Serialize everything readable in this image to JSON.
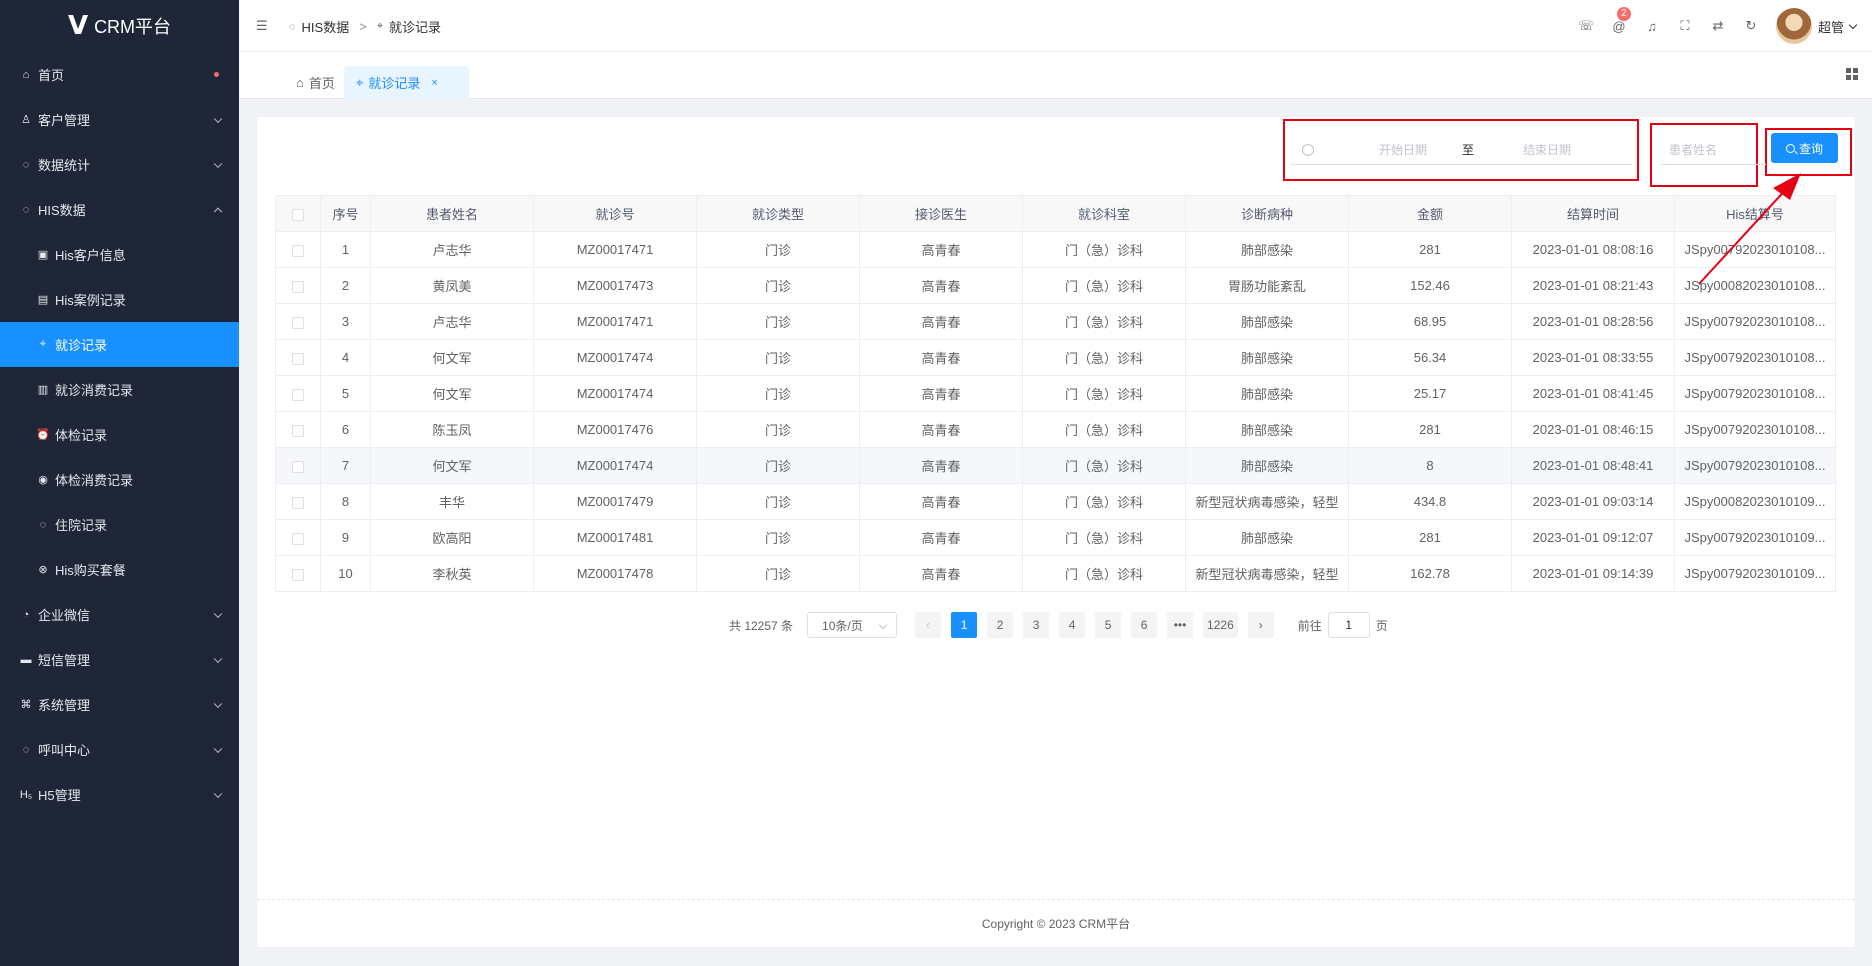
{
  "app": {
    "logo_glyph": "V",
    "title": "CRM平台"
  },
  "sidebar": {
    "items": [
      {
        "label": "首页",
        "icon": "home-icon",
        "glyph": "⌂",
        "has_dot": true
      },
      {
        "label": "客户管理",
        "icon": "user-icon",
        "glyph": "♙",
        "arrow": "down"
      },
      {
        "label": "数据统计",
        "icon": "chart-icon",
        "glyph": "◌",
        "arrow": "down"
      },
      {
        "label": "HIS数据",
        "icon": "data-icon",
        "glyph": "◌",
        "arrow": "up"
      },
      {
        "label": "His客户信息",
        "icon": "id-card-icon",
        "glyph": "▣",
        "sub": true
      },
      {
        "label": "His案例记录",
        "icon": "document-icon",
        "glyph": "▤",
        "sub": true
      },
      {
        "label": "就诊记录",
        "icon": "scan-icon",
        "glyph": "⌖",
        "sub": true,
        "active": true
      },
      {
        "label": "就诊消费记录",
        "icon": "wallet-icon",
        "glyph": "▥",
        "sub": true
      },
      {
        "label": "体检记录",
        "icon": "alarm-icon",
        "glyph": "⏰",
        "sub": true
      },
      {
        "label": "体检消费记录",
        "icon": "coin-icon",
        "glyph": "◉",
        "sub": true
      },
      {
        "label": "住院记录",
        "icon": "bed-icon",
        "glyph": "◌",
        "sub": true
      },
      {
        "label": "His购买套餐",
        "icon": "package-icon",
        "glyph": "⊗",
        "sub": true
      },
      {
        "label": "企业微信",
        "icon": "wechat-icon",
        "glyph": "◔",
        "arrow": "down"
      },
      {
        "label": "短信管理",
        "icon": "message-icon",
        "glyph": "▬",
        "arrow": "down"
      },
      {
        "label": "系统管理",
        "icon": "settings-icon",
        "glyph": "⌘",
        "arrow": "down"
      },
      {
        "label": "呼叫中心",
        "icon": "phone-call-icon",
        "glyph": "◌",
        "arrow": "down"
      },
      {
        "label": "H5管理",
        "icon": "h5-icon",
        "glyph": "H₅",
        "arrow": "down"
      }
    ]
  },
  "header": {
    "breadcrumb": [
      "HIS数据",
      "就诊记录"
    ],
    "separator": ">",
    "notification_count": "2",
    "username": "超管"
  },
  "tabs": [
    {
      "label": "首页",
      "icon": "home-icon"
    },
    {
      "label": "就诊记录",
      "icon": "scan-icon",
      "active": true,
      "close": "×"
    }
  ],
  "search": {
    "start_placeholder": "开始日期",
    "range_separator": "至",
    "end_placeholder": "结束日期",
    "name_placeholder": "患者姓名",
    "query_label": "查询"
  },
  "table": {
    "columns": [
      "序号",
      "患者姓名",
      "就诊号",
      "就诊类型",
      "接诊医生",
      "就诊科室",
      "诊断病种",
      "金额",
      "结算时间",
      "His结算号"
    ],
    "rows": [
      [
        "1",
        "卢志华",
        "MZ00017471",
        "门诊",
        "高青春",
        "门（急）诊科",
        "肺部感染",
        "281",
        "2023-01-01 08:08:16",
        "JSpy00792023010108..."
      ],
      [
        "2",
        "黄凤美",
        "MZ00017473",
        "门诊",
        "高青春",
        "门（急）诊科",
        "胃肠功能紊乱",
        "152.46",
        "2023-01-01 08:21:43",
        "JSpy00082023010108..."
      ],
      [
        "3",
        "卢志华",
        "MZ00017471",
        "门诊",
        "高青春",
        "门（急）诊科",
        "肺部感染",
        "68.95",
        "2023-01-01 08:28:56",
        "JSpy00792023010108..."
      ],
      [
        "4",
        "何文军",
        "MZ00017474",
        "门诊",
        "高青春",
        "门（急）诊科",
        "肺部感染",
        "56.34",
        "2023-01-01 08:33:55",
        "JSpy00792023010108..."
      ],
      [
        "5",
        "何文军",
        "MZ00017474",
        "门诊",
        "高青春",
        "门（急）诊科",
        "肺部感染",
        "25.17",
        "2023-01-01 08:41:45",
        "JSpy00792023010108..."
      ],
      [
        "6",
        "陈玉凤",
        "MZ00017476",
        "门诊",
        "高青春",
        "门（急）诊科",
        "肺部感染",
        "281",
        "2023-01-01 08:46:15",
        "JSpy00792023010108..."
      ],
      [
        "7",
        "何文军",
        "MZ00017474",
        "门诊",
        "高青春",
        "门（急）诊科",
        "肺部感染",
        "8",
        "2023-01-01 08:48:41",
        "JSpy00792023010108..."
      ],
      [
        "8",
        "丰华",
        "MZ00017479",
        "门诊",
        "高青春",
        "门（急）诊科",
        "新型冠状病毒感染，轻型",
        "434.8",
        "2023-01-01 09:03:14",
        "JSpy00082023010109..."
      ],
      [
        "9",
        "欧高阳",
        "MZ00017481",
        "门诊",
        "高青春",
        "门（急）诊科",
        "肺部感染",
        "281",
        "2023-01-01 09:12:07",
        "JSpy00792023010109..."
      ],
      [
        "10",
        "李秋英",
        "MZ00017478",
        "门诊",
        "高青春",
        "门（急）诊科",
        "新型冠状病毒感染，轻型",
        "162.78",
        "2023-01-01 09:14:39",
        "JSpy00792023010109..."
      ]
    ]
  },
  "pagination": {
    "total": "共 12257 条",
    "page_size": "10条/页",
    "pages": [
      "1",
      "2",
      "3",
      "4",
      "5",
      "6",
      "•••",
      "1226"
    ],
    "current": "1",
    "prev": "‹",
    "next": "›",
    "goto_label": "前往",
    "goto_value": "1",
    "goto_suffix": "页"
  },
  "footer": {
    "copyright": "Copyright ©  2023 CRM平台"
  },
  "colors": {
    "sidebar_bg": "#1f2637",
    "accent": "#1890ff",
    "highlight": "#e50012"
  }
}
